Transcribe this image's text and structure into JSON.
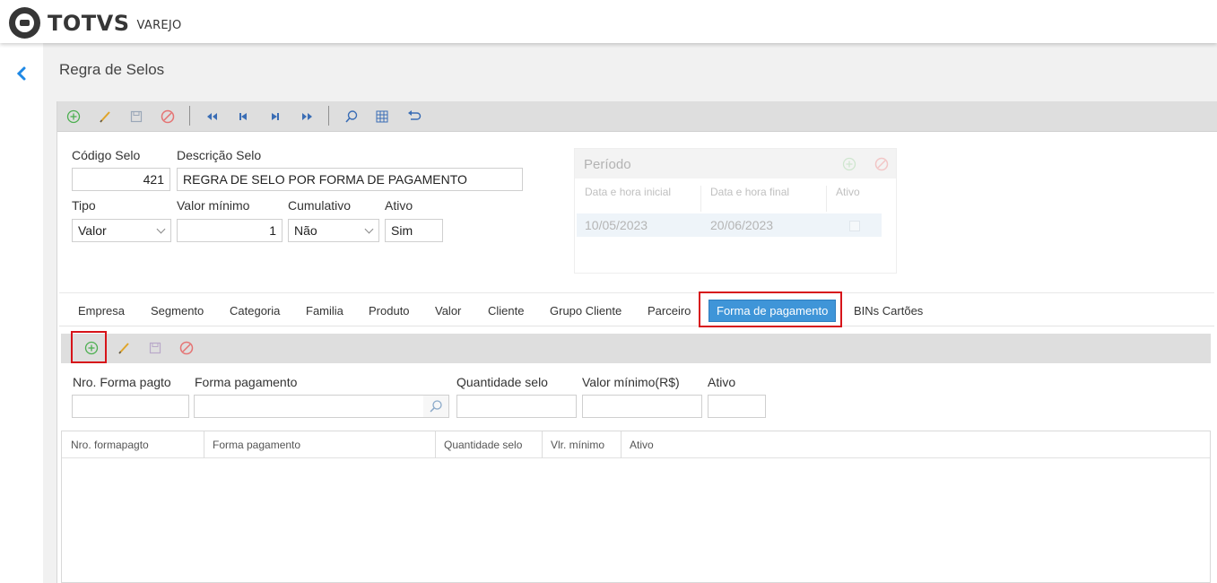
{
  "app": {
    "brand": "TOTVS",
    "product": "VAREJO"
  },
  "page": {
    "title": "Regra de Selos"
  },
  "toolbar": [
    "add-icon",
    "edit-icon",
    "save-icon",
    "cancel-icon",
    "first-icon",
    "previous-icon",
    "next-icon",
    "last-icon",
    "search-icon",
    "grid-icon",
    "undo-icon"
  ],
  "form": {
    "codigo_label": "Código Selo",
    "codigo_value": "421",
    "descricao_label": "Descrição Selo",
    "descricao_value": "REGRA DE SELO POR FORMA DE PAGAMENTO",
    "tipo_label": "Tipo",
    "tipo_value": "Valor",
    "valor_minimo_label": "Valor mínimo",
    "valor_minimo_value": "1",
    "cumulativo_label": "Cumulativo",
    "cumulativo_value": "Não",
    "ativo_label": "Ativo",
    "ativo_value": "Sim"
  },
  "periodo": {
    "title": "Período",
    "columns": [
      "Data e hora inicial",
      "Data e hora final",
      "Ativo"
    ],
    "rows": [
      {
        "inicial": "10/05/2023",
        "final": "20/06/2023",
        "ativo": false
      }
    ]
  },
  "tabs": [
    {
      "label": "Empresa"
    },
    {
      "label": "Segmento"
    },
    {
      "label": "Categoria"
    },
    {
      "label": "Familia"
    },
    {
      "label": "Produto"
    },
    {
      "label": "Valor"
    },
    {
      "label": "Cliente"
    },
    {
      "label": "Grupo Cliente"
    },
    {
      "label": "Parceiro"
    },
    {
      "label": "Forma de pagamento",
      "active": true
    },
    {
      "label": "BINs Cartões"
    }
  ],
  "subform": {
    "nro_label": "Nro. Forma pagto",
    "nro_value": "",
    "forma_label": "Forma pagamento",
    "forma_value": "",
    "quantidade_label": "Quantidade selo",
    "quantidade_value": "",
    "valor_label": "Valor mínimo(R$)",
    "valor_value": "",
    "ativo_label": "Ativo",
    "ativo_value": ""
  },
  "grid": {
    "columns": [
      "Nro. formapagto",
      "Forma pagamento",
      "Quantidade selo",
      "Vlr. mínimo",
      "Ativo"
    ],
    "rows": []
  },
  "colors": {
    "accent": "#3f95d8",
    "highlight": "#d7141a",
    "add_green": "#4caf50",
    "nav_blue": "#1e88e5"
  }
}
